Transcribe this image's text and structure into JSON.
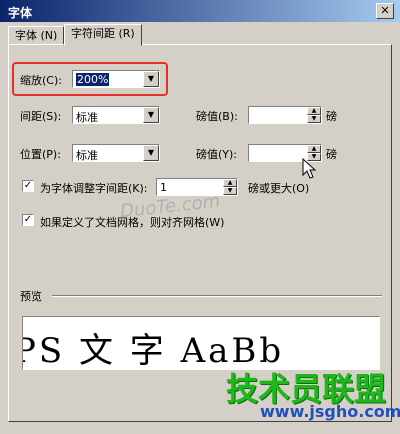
{
  "window": {
    "title": "字体",
    "close_glyph": "✕"
  },
  "tabs": [
    {
      "label": "字体 (N)",
      "active": false
    },
    {
      "label": "字符间距 (R)",
      "active": true
    }
  ],
  "scale": {
    "label": "缩放(C):",
    "value": "200%"
  },
  "spacing": {
    "label": "间距(S):",
    "value": "标准",
    "by_label": "磅值(B):",
    "by_value": "",
    "unit": "磅"
  },
  "position": {
    "label": "位置(P):",
    "value": "标准",
    "by_label": "磅值(Y):",
    "by_value": "",
    "unit": "磅"
  },
  "kerning": {
    "checked": true,
    "label": "为字体调整字间距(K):",
    "value": "1",
    "suffix": "磅或更大(O)"
  },
  "snap_grid": {
    "checked": true,
    "label": "如果定义了文档网格，则对齐网格(W)"
  },
  "preview": {
    "label": "预览",
    "sample": "PS 文 字  AaBb"
  },
  "watermarks": {
    "dialog": "DuoTe.com",
    "logo": "技术员联盟",
    "url": "www.jsgho.com"
  },
  "colors": {
    "highlight": "#e0322c",
    "title_bar": "#0a246a"
  }
}
